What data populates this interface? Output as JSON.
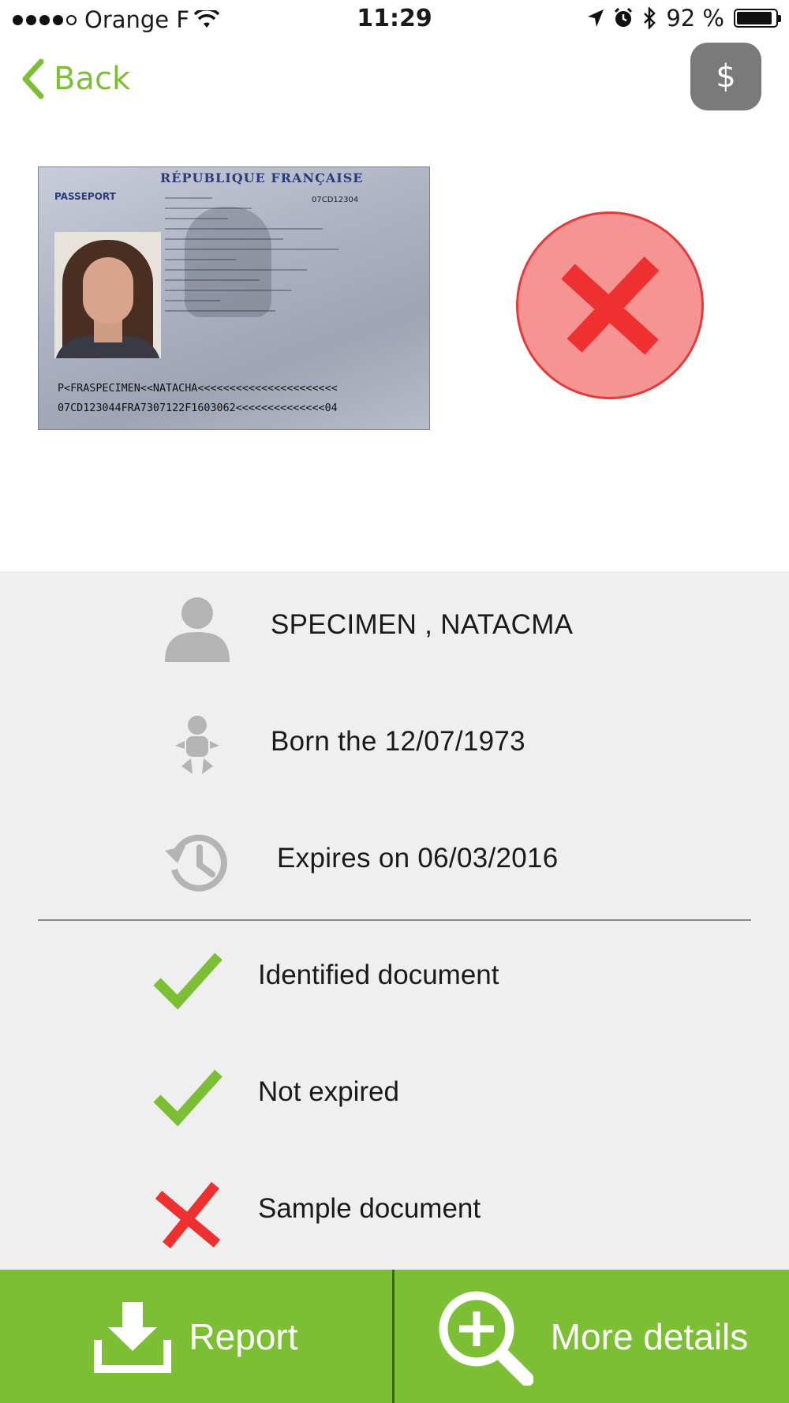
{
  "status_bar": {
    "carrier": "Orange F",
    "time": "11:29",
    "battery": "92 %",
    "battery_level_percent": 92,
    "signal_bars_filled": 4,
    "signal_bars_total": 5
  },
  "nav": {
    "back_label": "Back",
    "currency_label": "$"
  },
  "passport": {
    "country_header": "RÉPUBLIQUE FRANÇAISE",
    "doc_type_label": "PASSEPORT",
    "doc_number": "07CD12304",
    "mrz_line1": "P<FRASPECIMEN<<NATACHA<<<<<<<<<<<<<<<<<<<<<<",
    "mrz_line2": "07CD123044FRA7307122F1603062<<<<<<<<<<<<<<04"
  },
  "verification": {
    "overall_status": "failed"
  },
  "info": {
    "name": "SPECIMEN , NATACMA",
    "birth": "Born the 12/07/1973",
    "expiry": "Expires on 06/03/2016"
  },
  "checks": [
    {
      "label": "Identified document",
      "status": "pass"
    },
    {
      "label": "Not expired",
      "status": "pass"
    },
    {
      "label": "Sample document",
      "status": "fail"
    }
  ],
  "actions": {
    "report_label": "Report",
    "details_label": "More details"
  },
  "colors": {
    "accent_green": "#7dbf34",
    "fail_red": "#e53a3a",
    "fail_circle_fill": "#f59493",
    "panel_bg": "#efefef",
    "icon_gray": "#b4b4b4"
  }
}
